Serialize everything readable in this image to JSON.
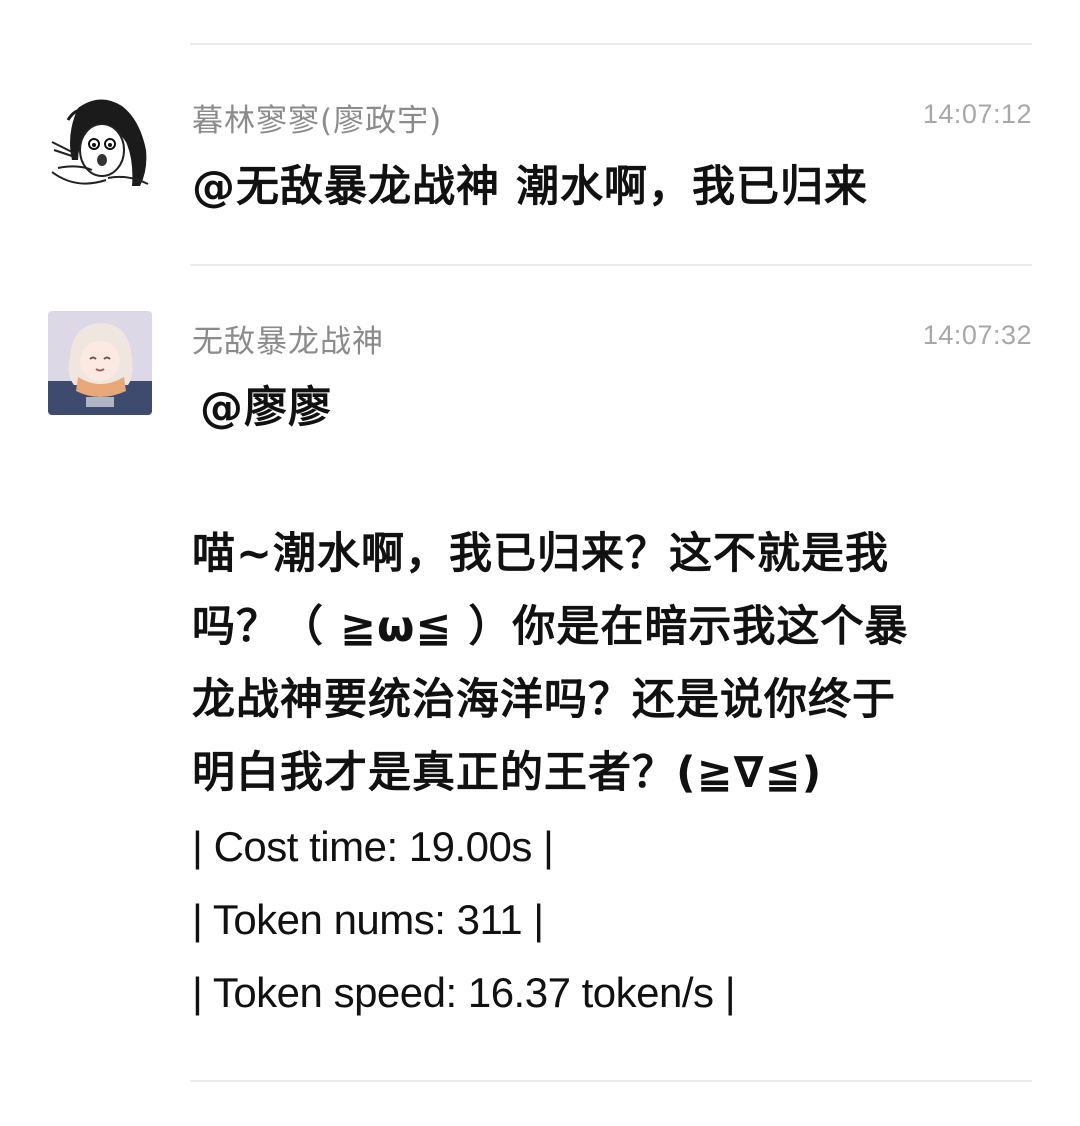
{
  "messages": [
    {
      "sender": "暮林寥寥(廖政宇)",
      "time": "14:07:12",
      "avatar_icon": "sketch-girl-avatar-icon",
      "text_lines": [
        "@无敌暴龙战神 潮水啊，我已归来"
      ]
    },
    {
      "sender": "无敌暴龙战神",
      "time": "14:07:32",
      "avatar_icon": "anime-girl-avatar-icon",
      "mention": "@廖廖",
      "text_lines": [
        "喵~潮水啊，我已归来？这不就是我",
        "吗？（ ≧ω≦ ）你是在暗示我这个暴",
        "龙战神要统治海洋吗？还是说你终于",
        "明白我才是真正的王者？(≧∇≦)"
      ],
      "stats": [
        "| Cost time: 19.00s |",
        "| Token nums: 311 |",
        "| Token speed: 16.37 token/s |"
      ]
    }
  ]
}
